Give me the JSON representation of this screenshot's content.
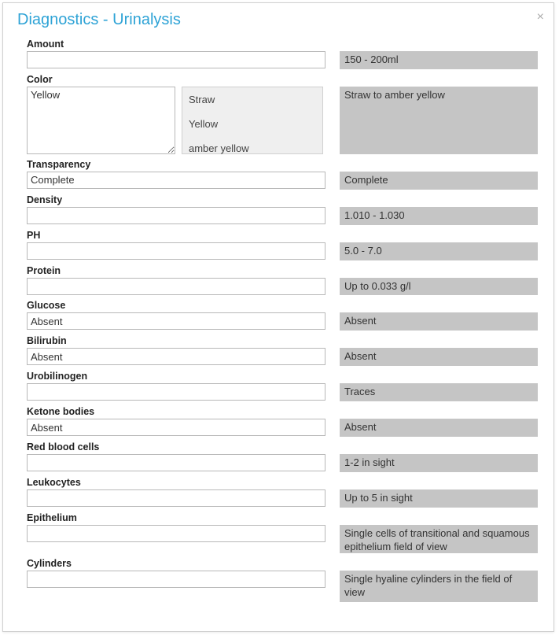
{
  "header": {
    "title": "Diagnostics - Urinalysis",
    "close": "×"
  },
  "fields": {
    "amount": {
      "label": "Amount",
      "value": "",
      "ref": "150 - 200ml"
    },
    "color": {
      "label": "Color",
      "value": "Yellow",
      "ref": "Straw to amber yellow",
      "options": {
        "o1": "Straw",
        "o2": "Yellow",
        "o3": "amber yellow"
      }
    },
    "transparency": {
      "label": "Transparency",
      "value": "Complete",
      "ref": "Complete"
    },
    "density": {
      "label": "Density",
      "value": "",
      "ref": "1.010 - 1.030"
    },
    "ph": {
      "label": "PH",
      "value": "",
      "ref": "5.0 - 7.0"
    },
    "protein": {
      "label": "Protein",
      "value": "",
      "ref": "Up to 0.033 g/l"
    },
    "glucose": {
      "label": "Glucose",
      "value": "Absent",
      "ref": "Absent"
    },
    "bilirubin": {
      "label": "Bilirubin",
      "value": "Absent",
      "ref": "Absent"
    },
    "urobilinogen": {
      "label": "Urobilinogen",
      "value": "",
      "ref": "Traces"
    },
    "ketone": {
      "label": "Ketone bodies",
      "value": "Absent",
      "ref": "Absent"
    },
    "rbc": {
      "label": "Red blood cells",
      "value": "",
      "ref": "1-2 in sight"
    },
    "leukocytes": {
      "label": "Leukocytes",
      "value": "",
      "ref": "Up to 5 in sight"
    },
    "epithelium": {
      "label": "Epithelium",
      "value": "",
      "ref": "Single cells of transitional and squamous epithelium field of view"
    },
    "cylinders": {
      "label": "Cylinders",
      "value": "",
      "ref": "Single hyaline cylinders in the field of view"
    }
  }
}
